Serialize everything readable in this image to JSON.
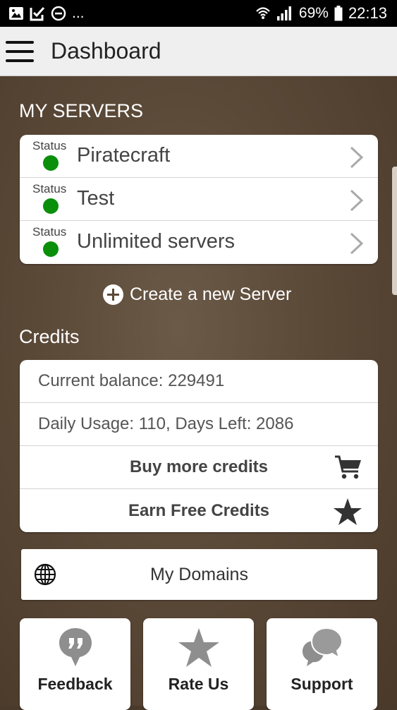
{
  "status_bar": {
    "more": "...",
    "battery": "69%",
    "time": "22:13"
  },
  "app_bar": {
    "title": "Dashboard"
  },
  "servers": {
    "section_title": "MY SERVERS",
    "items": [
      {
        "status_label": "Status",
        "name": "Piratecraft",
        "status_color": "#0a8f0a"
      },
      {
        "status_label": "Status",
        "name": "Test",
        "status_color": "#0a8f0a"
      },
      {
        "status_label": "Status",
        "name": "Unlimited servers",
        "status_color": "#0a8f0a"
      }
    ],
    "create_label": "Create a new Server"
  },
  "credits": {
    "section_title": "Credits",
    "balance_text": "Current balance: 229491",
    "usage_text": "Daily Usage: 110, Days Left: 2086",
    "buy_label": "Buy more credits",
    "buy_icon": "cart-icon",
    "earn_label": "Earn Free Credits",
    "earn_icon": "star-icon"
  },
  "domains": {
    "label": "My Domains",
    "icon": "globe-icon"
  },
  "tiles": [
    {
      "label": "Feedback",
      "icon": "quote-bubble-icon"
    },
    {
      "label": "Rate Us",
      "icon": "star-icon"
    },
    {
      "label": "Support",
      "icon": "chat-bubbles-icon"
    }
  ],
  "colors": {
    "background": "#5b4938",
    "app_bar": "#efefef",
    "status_online": "#0a8f0a",
    "icon_grey": "#8e8e8e"
  }
}
